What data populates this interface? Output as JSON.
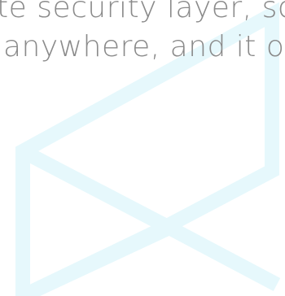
{
  "text": {
    "line1": "te security layer, so",
    "line2": "anywhere, and it onl"
  },
  "colors": {
    "text": "#8a8a8a",
    "watermark": "#e6f8fc"
  },
  "icons": {
    "background_mark": "hexagon-x-logo-watermark"
  }
}
